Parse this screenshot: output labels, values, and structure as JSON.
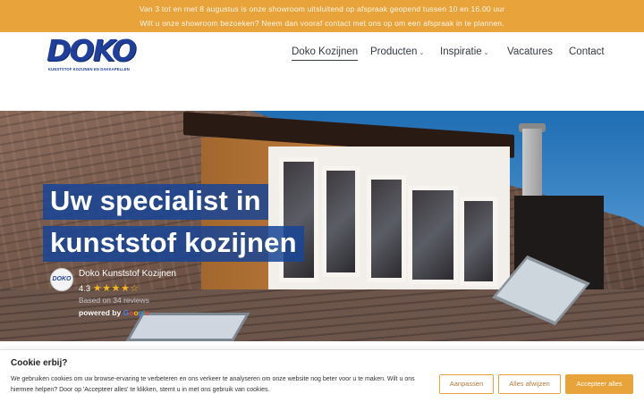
{
  "topbar": {
    "line1": "Van 3 tot en met 8 augustus is onze showroom uitsluitend op afspraak geopend tussen 10 en 16.00 uur",
    "line2": "Wilt u onze showroom bezoeken? Neem dan vooraf contact met ons op om een afspraak in te plannen."
  },
  "logo": {
    "word": "DOKO",
    "tagline": "KUNSTSTOF KOZIJNEN EN DAKKAPELLEN"
  },
  "nav": {
    "items": [
      {
        "label": "Doko Kozijnen",
        "active": true,
        "dropdown": false
      },
      {
        "label": "Producten",
        "active": false,
        "dropdown": true
      },
      {
        "label": "Inspiratie",
        "active": false,
        "dropdown": true
      },
      {
        "label": "Vacatures",
        "active": false,
        "dropdown": false
      },
      {
        "label": "Contact",
        "active": false,
        "dropdown": false
      }
    ],
    "caret": "⌄"
  },
  "hero": {
    "headline_line1": "Uw specialist in",
    "headline_line2": "kunststof kozijnen"
  },
  "review": {
    "badge": "DOKO",
    "business": "Doko Kunststof Kozijnen",
    "rating": "4.3",
    "stars": "★★★★☆",
    "count": "Based on 34 reviews",
    "powered_by": "powered by",
    "google": [
      "G",
      "o",
      "o",
      "g",
      "l",
      "e"
    ]
  },
  "cookie": {
    "title": "Cookie erbij?",
    "text": "We gebruiken cookies om uw browse-ervaring te verbeteren en ons verkeer te analyseren om onze website nog beter voor u te maken. Wilt u ons hiermee helpen? Door op 'Accepteer alles' te klikken, stemt u in met ons gebruik van cookies.",
    "btn_customize": "Aanpassen",
    "btn_reject": "Alles afwijzen",
    "btn_accept": "Accepteer alles"
  },
  "colors": {
    "accent": "#e8a33a",
    "brand_blue": "#1f3f9a"
  }
}
